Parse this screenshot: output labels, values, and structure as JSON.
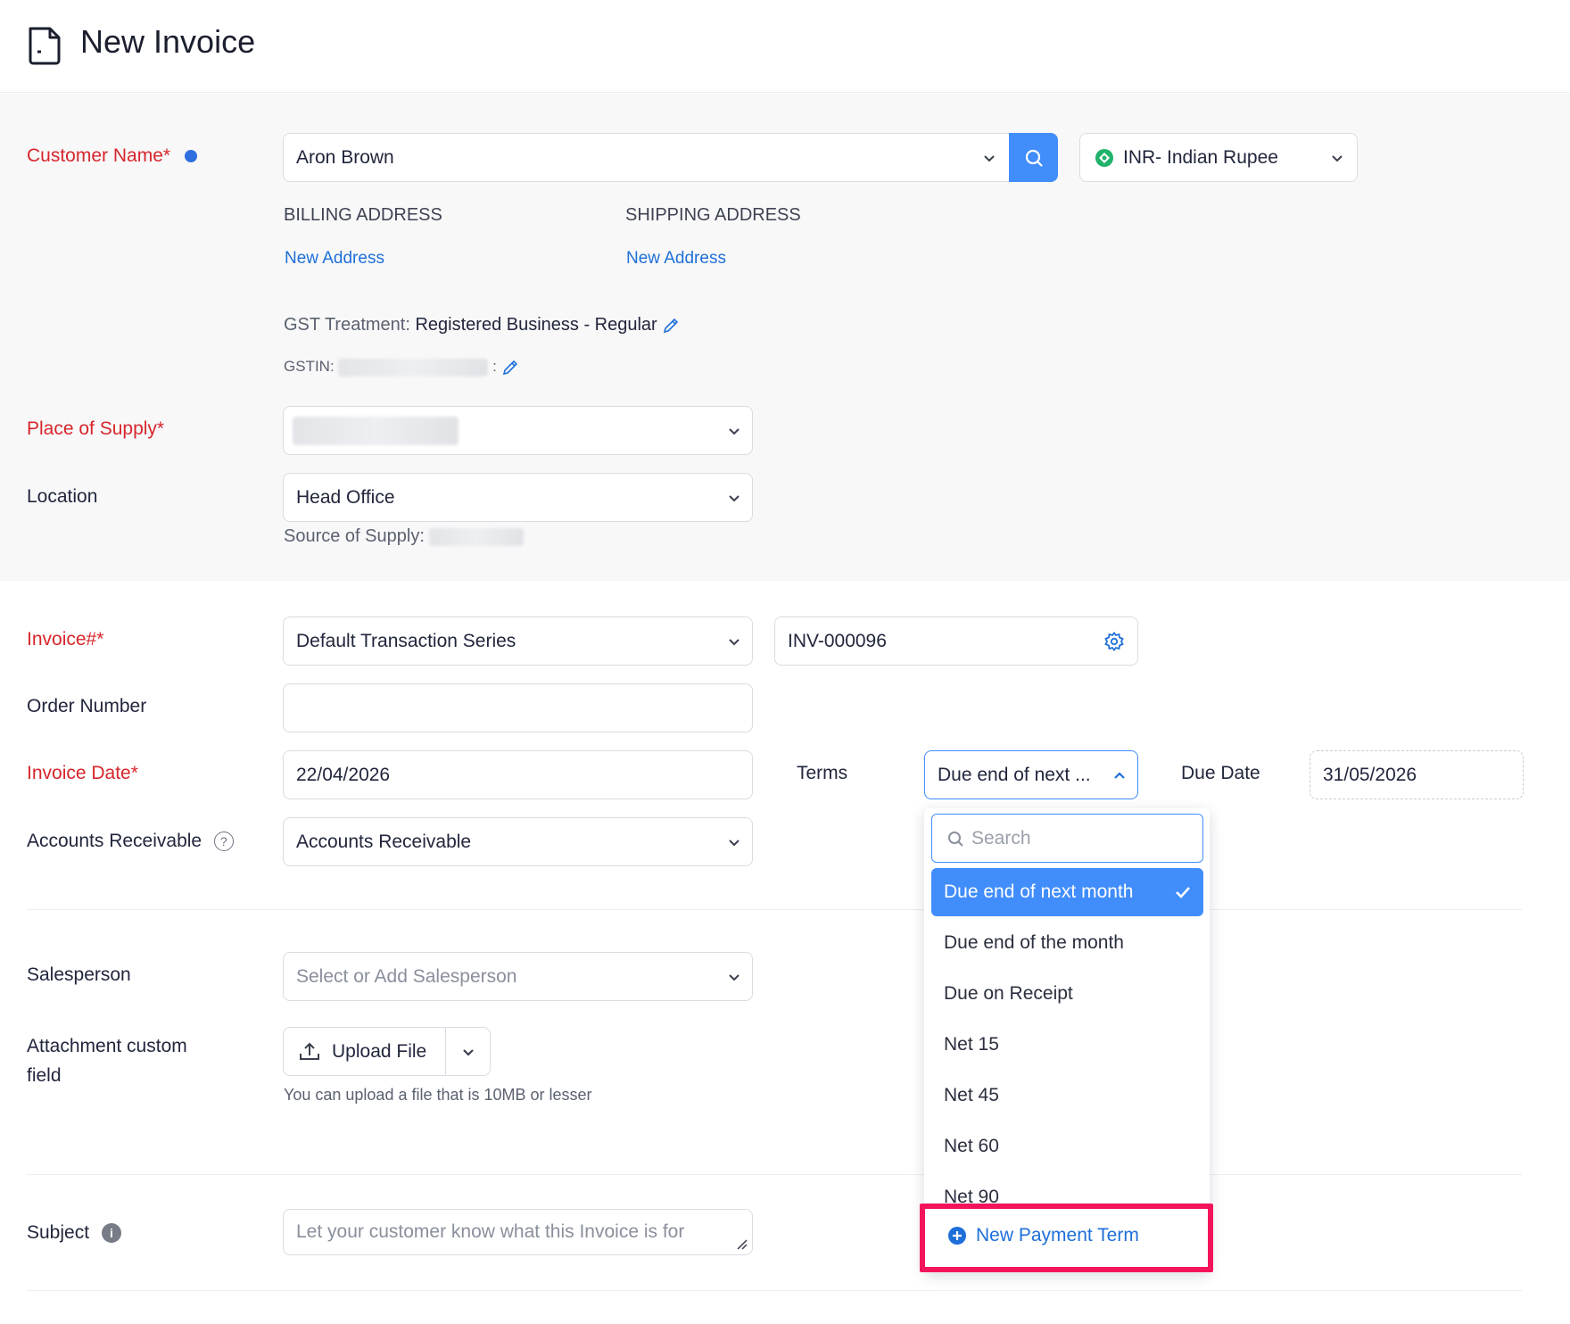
{
  "header": {
    "title": "New Invoice"
  },
  "customer": {
    "label": "Customer Name*",
    "value": "Aron Brown",
    "currency": "INR- Indian Rupee",
    "billing_label": "BILLING ADDRESS",
    "shipping_label": "SHIPPING ADDRESS",
    "billing_link": "New Address",
    "shipping_link": "New Address",
    "gst_treatment_label": "GST Treatment:",
    "gst_treatment_value": "Registered Business - Regular",
    "gstin_label": "GSTIN:",
    "gstin_sep": ":"
  },
  "supply": {
    "place_label": "Place of Supply*",
    "location_label": "Location",
    "location_value": "Head Office",
    "source_label": "Source of Supply:"
  },
  "invoice": {
    "number_label": "Invoice#*",
    "series_value": "Default Transaction Series",
    "number_value": "INV-000096",
    "order_label": "Order Number",
    "order_value": "",
    "date_label": "Invoice Date*",
    "date_value": "22/04/2026",
    "terms_label": "Terms",
    "terms_value": "Due end of next ...",
    "due_label": "Due Date",
    "due_value": "31/05/2026",
    "ar_label": "Accounts Receivable",
    "ar_value": "Accounts Receivable"
  },
  "terms_dropdown": {
    "search_placeholder": "Search",
    "options": [
      {
        "label": "Due end of next month",
        "selected": true
      },
      {
        "label": "Due end of the month",
        "selected": false
      },
      {
        "label": "Due on Receipt",
        "selected": false
      },
      {
        "label": "Net 15",
        "selected": false
      },
      {
        "label": "Net 45",
        "selected": false
      },
      {
        "label": "Net 60",
        "selected": false
      },
      {
        "label": "Net 90",
        "selected": false
      }
    ],
    "new_term_label": "New Payment Term"
  },
  "extra": {
    "salesperson_label": "Salesperson",
    "salesperson_placeholder": "Select or Add Salesperson",
    "attachment_label_line1": "Attachment custom",
    "attachment_label_line2": "field",
    "upload_label": "Upload File",
    "upload_hint": "You can upload a file that is 10MB or lesser",
    "subject_label": "Subject",
    "subject_placeholder": "Let your customer know what this Invoice is for"
  },
  "colors": {
    "accent": "#408dfb",
    "required": "#d6262b",
    "link": "#1e6fd9",
    "highlight": "#f4145c",
    "status_dot": "#2e6fdf",
    "currency_icon": "#20b26b"
  }
}
